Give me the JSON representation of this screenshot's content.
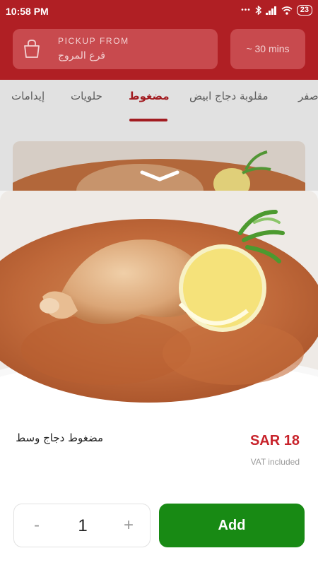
{
  "status_bar": {
    "time": "10:58 PM",
    "battery": "23",
    "icons": [
      "more-dots-icon",
      "bluetooth-icon",
      "signal-icon",
      "wifi-icon",
      "battery-icon"
    ]
  },
  "header": {
    "pickup_label": "PICKUP FROM",
    "branch": "فرع المروج",
    "eta": "~ 30 mins"
  },
  "tabs": [
    {
      "label": "إيدامات"
    },
    {
      "label": "حلويات"
    },
    {
      "label": "مضغوط",
      "active": true
    },
    {
      "label": "مقلوبة دجاج ابيض"
    },
    {
      "label": "صفر"
    }
  ],
  "item": {
    "name": "مضغوط دجاج وسط",
    "price": "SAR 18",
    "vat_note": "VAT included",
    "quantity": "1",
    "minus_label": "-",
    "plus_label": "+",
    "add_label": "Add"
  },
  "colors": {
    "brand_red": "#b01f24",
    "price_red": "#c8232b",
    "add_green": "#188a14"
  }
}
